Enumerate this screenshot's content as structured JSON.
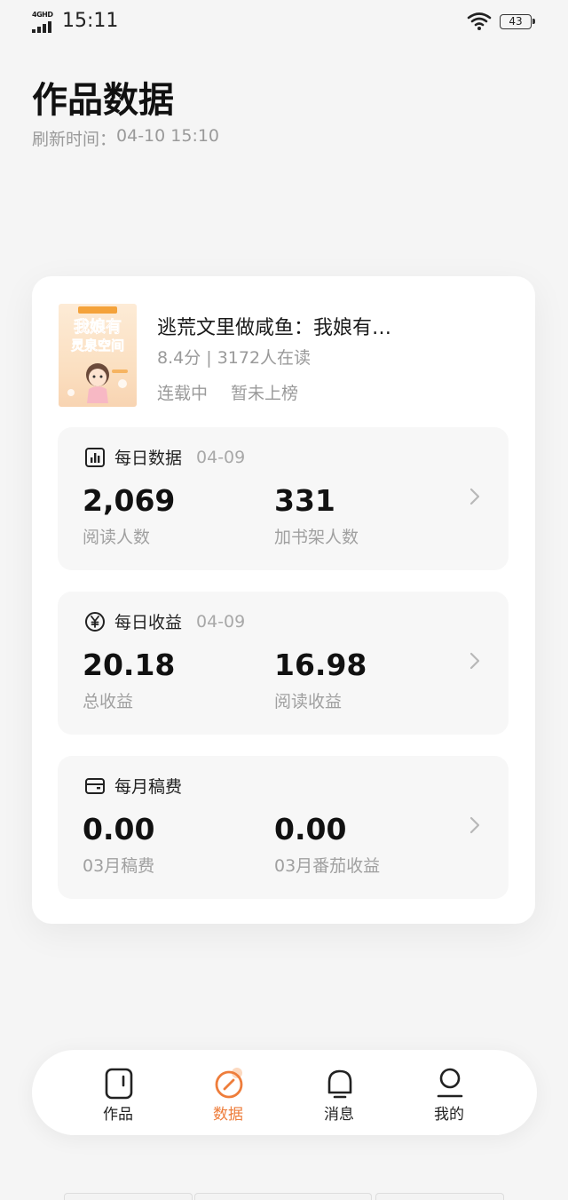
{
  "status_bar": {
    "network": "4GHD",
    "time": "15:11",
    "battery": "43"
  },
  "header": {
    "title": "作品数据",
    "refresh_label": "刷新时间：",
    "refresh_time": "04-10 15:10"
  },
  "book": {
    "cover_text_1": "我娘有",
    "cover_text_2": "灵泉空间",
    "title": "逃荒文里做咸鱼：我娘有…",
    "meta": "8.4分 | 3172人在读",
    "status": "连载中",
    "rank": "暂未上榜"
  },
  "daily_data": {
    "label": "每日数据",
    "date": "04-09",
    "value1": "2,069",
    "sub1": "阅读人数",
    "value2": "331",
    "sub2": "加书架人数"
  },
  "daily_income": {
    "label": "每日收益",
    "date": "04-09",
    "value1": "20.18",
    "sub1": "总收益",
    "value2": "16.98",
    "sub2": "阅读收益"
  },
  "monthly_fee": {
    "label": "每月稿费",
    "value1": "0.00",
    "sub1": "03月稿费",
    "value2": "0.00",
    "sub2": "03月番茄收益"
  },
  "tabbar": {
    "items": [
      {
        "label": "作品",
        "icon": "book-icon"
      },
      {
        "label": "数据",
        "icon": "data-compass-icon"
      },
      {
        "label": "消息",
        "icon": "bell-icon"
      },
      {
        "label": "我的",
        "icon": "user-icon"
      }
    ],
    "active": "数据"
  },
  "colors": {
    "accent": "#ee7d3b",
    "background": "#f5f5f5",
    "card": "#ffffff",
    "block": "#f7f7f7"
  }
}
